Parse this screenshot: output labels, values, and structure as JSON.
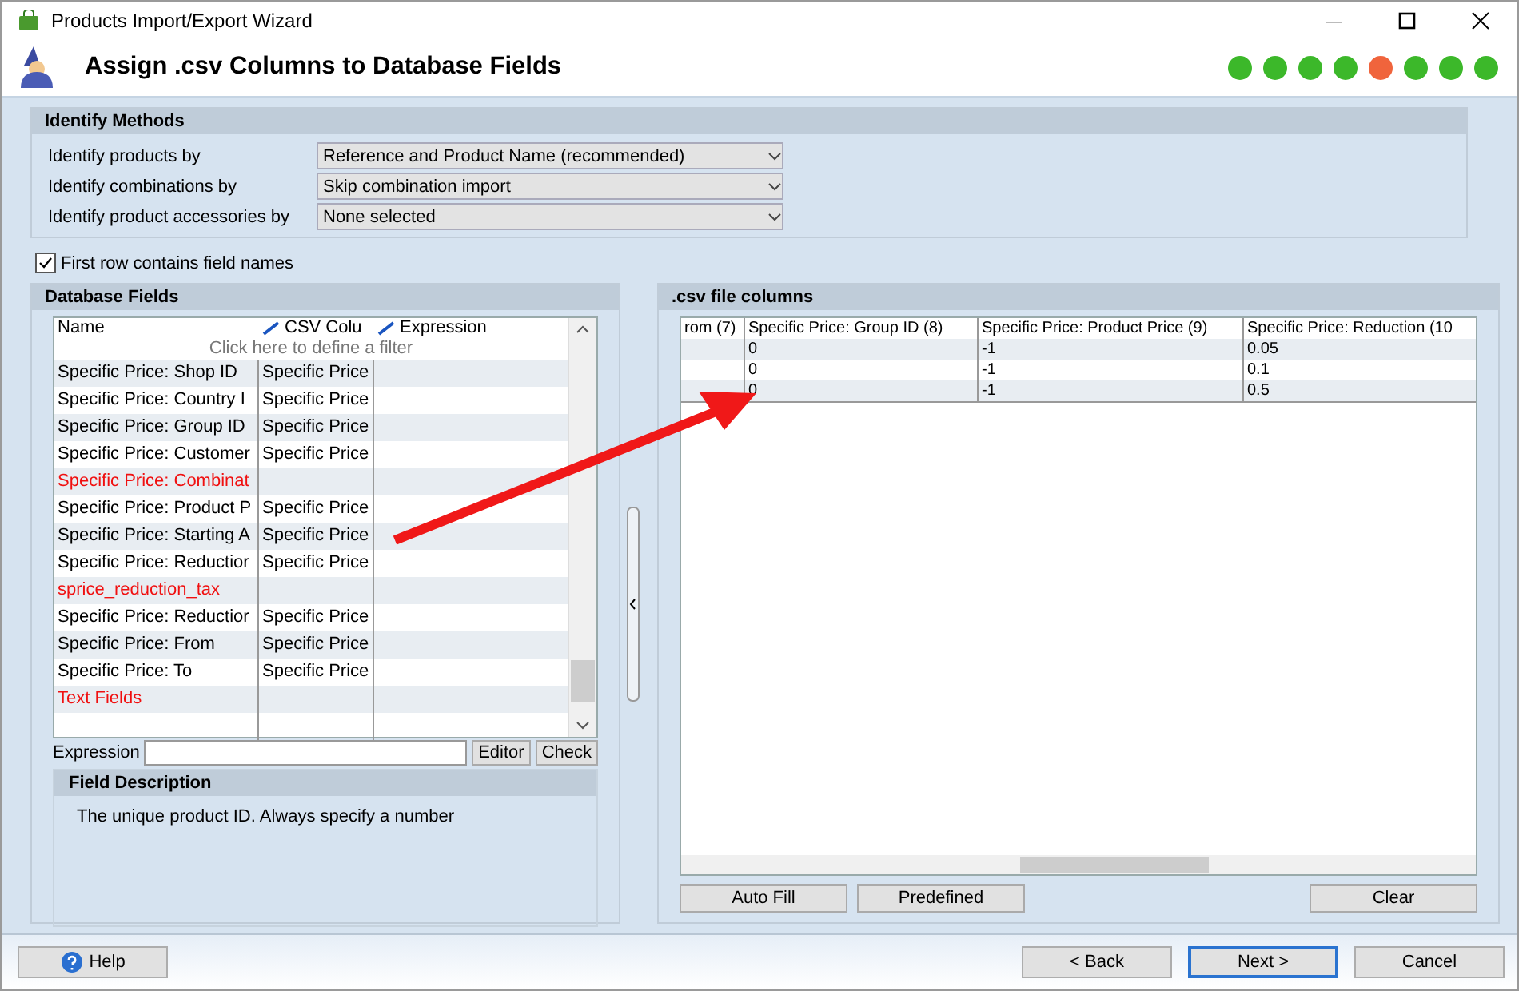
{
  "window": {
    "title": "Products Import/Export Wizard"
  },
  "header": {
    "title": "Assign .csv Columns to Database Fields",
    "steps": [
      {
        "color": "#3cb82a"
      },
      {
        "color": "#3cb82a"
      },
      {
        "color": "#3cb82a"
      },
      {
        "color": "#3cb82a"
      },
      {
        "color": "#f0643c"
      },
      {
        "color": "#3cb82a"
      },
      {
        "color": "#3cb82a"
      },
      {
        "color": "#3cb82a"
      }
    ]
  },
  "identify_methods": {
    "title": "Identify Methods",
    "rows": [
      {
        "label": "Identify products by",
        "value": "Reference and Product Name (recommended)"
      },
      {
        "label": "Identify combinations by",
        "value": "Skip combination import"
      },
      {
        "label": "Identify product accessories by",
        "value": "None selected"
      }
    ]
  },
  "first_row_names": {
    "label": "First row contains field names",
    "checked": true
  },
  "database_fields": {
    "title": "Database Fields",
    "columns": [
      "Name",
      "CSV Colu",
      "Expression"
    ],
    "filter_hint": "Click here to define a filter",
    "rows": [
      {
        "name": "Specific Price: Shop ID",
        "csv": "Specific Price",
        "highlighted": false
      },
      {
        "name": "Specific Price: Country I",
        "csv": "Specific Price",
        "highlighted": false
      },
      {
        "name": "Specific Price: Group ID",
        "csv": "Specific Price",
        "highlighted": false
      },
      {
        "name": "Specific Price: Customer",
        "csv": "Specific Price",
        "highlighted": false
      },
      {
        "name": "Specific Price: Combinat",
        "highlighted": true
      },
      {
        "name": "Specific Price: Product P",
        "csv": "Specific Price",
        "highlighted": false
      },
      {
        "name": "Specific Price: Starting A",
        "csv": "Specific Price",
        "highlighted": false
      },
      {
        "name": "Specific Price: Reductior",
        "csv": "Specific Price",
        "highlighted": false
      },
      {
        "name": "sprice_reduction_tax",
        "highlighted": true
      },
      {
        "name": "Specific Price: Reductior",
        "csv": "Specific Price",
        "highlighted": false
      },
      {
        "name": "Specific Price: From",
        "csv": "Specific Price",
        "highlighted": false
      },
      {
        "name": "Specific Price: To",
        "csv": "Specific Price",
        "highlighted": false
      },
      {
        "name": "Text Fields",
        "highlighted": true
      }
    ],
    "expression_label": "Expression",
    "editor_button": "Editor",
    "check_button": "Check",
    "description_title": "Field Description",
    "description": "The unique product ID. Always specify a number"
  },
  "csv_columns": {
    "title": ".csv file columns",
    "columns": [
      "rom (7)",
      "Specific Price: Group ID (8)",
      "Specific Price: Product Price (9)",
      "Specific Price: Reduction (10"
    ],
    "rows": [
      {
        "cells": [
          "",
          "0",
          "-1",
          "0.05"
        ]
      },
      {
        "cells": [
          "",
          "0",
          "-1",
          "0.1"
        ]
      },
      {
        "cells": [
          "",
          "0",
          "-1",
          "0.5"
        ]
      }
    ],
    "buttons": [
      "Auto Fill",
      "Predefined",
      "Clear"
    ]
  },
  "footer": {
    "help": "Help",
    "back": "< Back",
    "next": "Next >",
    "cancel": "Cancel"
  }
}
